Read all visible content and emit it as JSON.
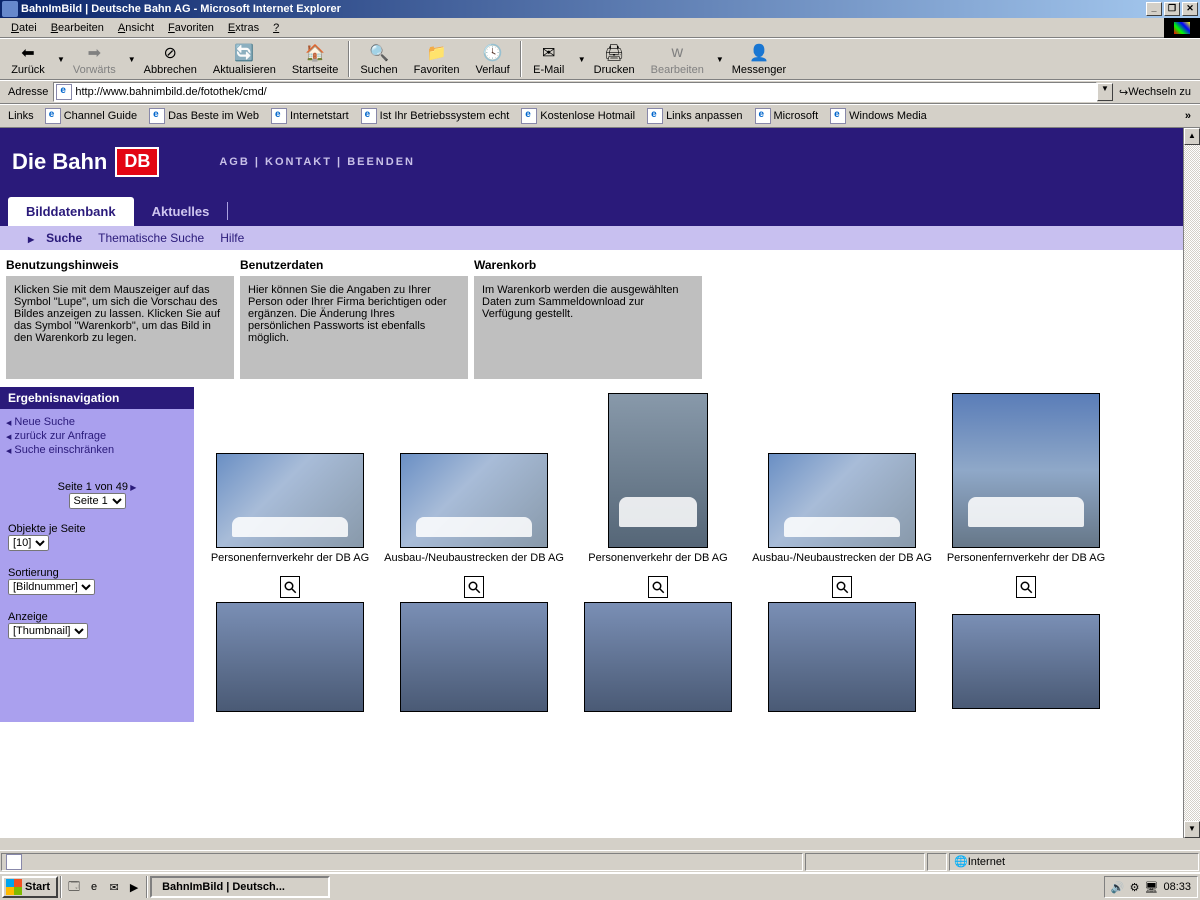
{
  "window": {
    "title": "BahnImBild | Deutsche Bahn AG - Microsoft Internet Explorer"
  },
  "menubar": {
    "items": [
      "Datei",
      "Bearbeiten",
      "Ansicht",
      "Favoriten",
      "Extras",
      "?"
    ]
  },
  "toolbar": {
    "back": "Zurück",
    "forward": "Vorwärts",
    "stop": "Abbrechen",
    "refresh": "Aktualisieren",
    "home": "Startseite",
    "search": "Suchen",
    "favorites": "Favoriten",
    "history": "Verlauf",
    "mail": "E-Mail",
    "print": "Drucken",
    "edit": "Bearbeiten",
    "messenger": "Messenger"
  },
  "addressbar": {
    "label": "Adresse",
    "url": "http://www.bahnimbild.de/fotothek/cmd/",
    "go": "Wechseln zu"
  },
  "linksbar": {
    "label": "Links",
    "items": [
      "Channel Guide",
      "Das Beste im Web",
      "Internetstart",
      "Ist Ihr Betriebssystem echt",
      "Kostenlose Hotmail",
      "Links anpassen",
      "Microsoft",
      "Windows Media"
    ]
  },
  "site": {
    "brand": "Die Bahn",
    "logo": "DB",
    "toplinks": {
      "agb": "AGB",
      "kontakt": "KONTAKT",
      "beenden": "BEENDEN",
      "sep": " | "
    },
    "tabs": {
      "db": "Bilddatenbank",
      "news": "Aktuelles"
    },
    "subnav": {
      "suche": "Suche",
      "them": "Thematische Suche",
      "hilfe": "Hilfe"
    }
  },
  "infoboxes": {
    "b1": {
      "title": "Benutzungshinweis",
      "body": "Klicken Sie mit dem Mauszeiger auf das Symbol \"Lupe\", um sich die Vorschau des Bildes anzeigen zu lassen. Klicken Sie auf das Symbol \"Warenkorb\", um das Bild in den Warenkorb zu legen."
    },
    "b2": {
      "title": "Benutzerdaten",
      "body": "Hier können Sie die Angaben zu Ihrer Person oder Ihrer Firma berichtigen oder ergänzen. Die Änderung Ihres persönlichen Passworts ist ebenfalls möglich."
    },
    "b3": {
      "title": "Warenkorb",
      "body": "Im Warenkorb werden die ausgewählten Daten zum Sammeldownload zur Verfügung gestellt."
    }
  },
  "sidenav": {
    "hd": "Ergebnisnavigation",
    "l1": "Neue Suche",
    "l2": "zurück zur Anfrage",
    "l3": "Suche einschränken",
    "pager": "Seite 1 von 49",
    "pageselect": "Seite 1",
    "perpage_lbl": "Objekte je Seite",
    "perpage_val": "[10]",
    "sort_lbl": "Sortierung",
    "sort_val": "[Bildnummer]",
    "view_lbl": "Anzeige",
    "view_val": "[Thumbnail]"
  },
  "thumbs": {
    "c1": "Personenfernverkehr der DB AG",
    "c2": "Ausbau-/Neubaustrecken der DB AG",
    "c3": "Personenverkehr der DB AG",
    "c4": "Ausbau-/Neubaustrecken der DB AG",
    "c5": "Personenfernverkehr der DB AG"
  },
  "statusbar": {
    "zone": "Internet"
  },
  "taskbar": {
    "start": "Start",
    "task": "BahnImBild | Deutsch...",
    "clock": "08:33"
  }
}
